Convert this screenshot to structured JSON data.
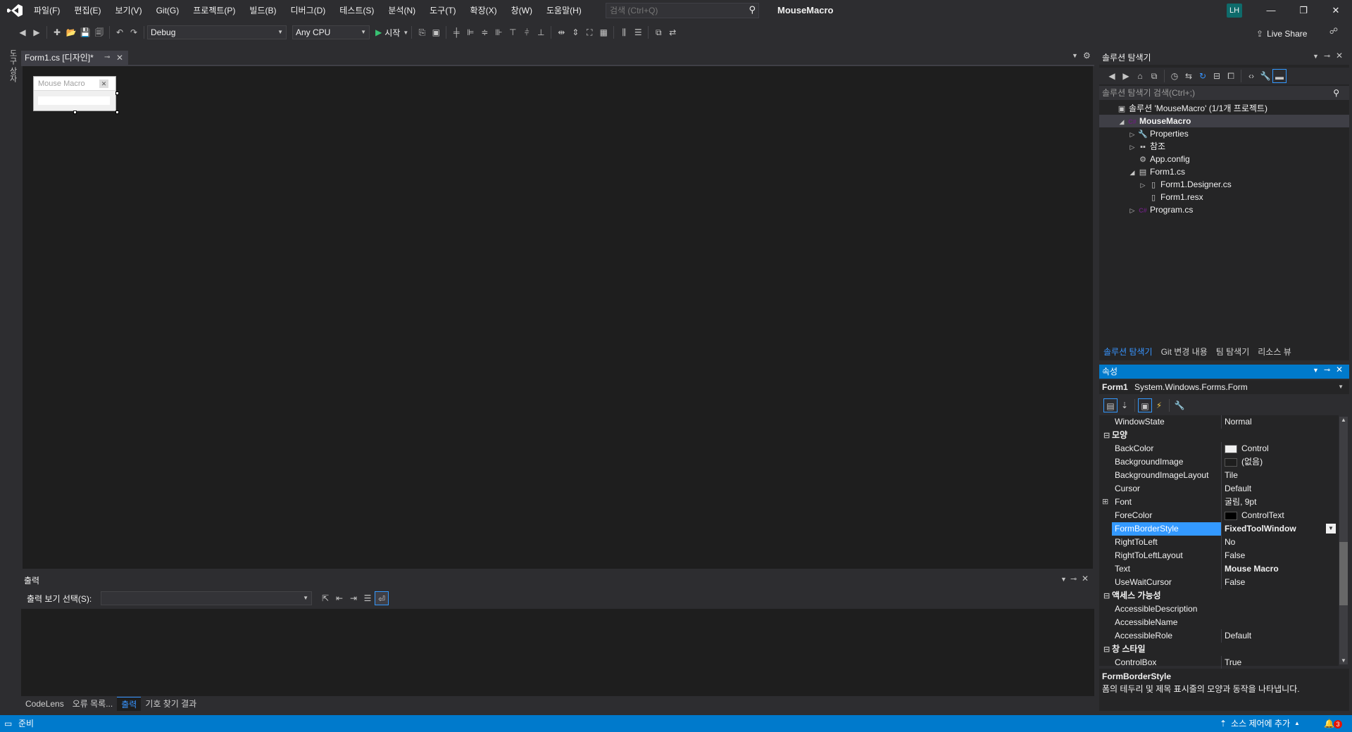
{
  "menu": {
    "items": [
      "파일(F)",
      "편집(E)",
      "보기(V)",
      "Git(G)",
      "프로젝트(P)",
      "빌드(B)",
      "디버그(D)",
      "테스트(S)",
      "분석(N)",
      "도구(T)",
      "확장(X)",
      "창(W)",
      "도움말(H)"
    ],
    "search_placeholder": "검색 (Ctrl+Q)",
    "solution_name": "MouseMacro",
    "avatar_initials": "LH"
  },
  "toolbar": {
    "configuration": "Debug",
    "platform": "Any CPU",
    "start_label": "시작",
    "live_share_label": "Live Share"
  },
  "left_strip": {
    "toolbox_label": "도구 상자"
  },
  "document": {
    "tab_title": "Form1.cs [디자인]*",
    "form_title": "Mouse Macro"
  },
  "output": {
    "title": "출력",
    "source_label": "출력 보기 선택(S):",
    "source_value": ""
  },
  "bottom_tabs": [
    {
      "label": "CodeLens",
      "active": false
    },
    {
      "label": "오류 목록...",
      "active": false
    },
    {
      "label": "출력",
      "active": true
    },
    {
      "label": "기호 찾기 결과",
      "active": false
    }
  ],
  "solution_explorer": {
    "title": "솔루션 탐색기",
    "search_placeholder": "솔루션 탐색기 검색(Ctrl+;)",
    "tree": [
      {
        "label": "솔루션 'MouseMacro' (1/1개 프로젝트)",
        "icon": "solution-icon",
        "glyph": "▣",
        "twisty": "",
        "indent": 0,
        "bold": false,
        "selected": false
      },
      {
        "label": "MouseMacro",
        "icon": "csharp-project-icon",
        "glyph": "C#",
        "twisty": "◢",
        "indent": 1,
        "bold": true,
        "selected": true
      },
      {
        "label": "Properties",
        "icon": "wrench-icon",
        "glyph": "🔧",
        "twisty": "▷",
        "indent": 2,
        "bold": false,
        "selected": false
      },
      {
        "label": "참조",
        "icon": "references-icon",
        "glyph": "▪▪",
        "twisty": "▷",
        "indent": 2,
        "bold": false,
        "selected": false
      },
      {
        "label": "App.config",
        "icon": "config-file-icon",
        "glyph": "⚙",
        "twisty": "",
        "indent": 2,
        "bold": false,
        "selected": false
      },
      {
        "label": "Form1.cs",
        "icon": "form-icon",
        "glyph": "▤",
        "twisty": "◢",
        "indent": 2,
        "bold": false,
        "selected": false
      },
      {
        "label": "Form1.Designer.cs",
        "icon": "code-file-icon",
        "glyph": "▯",
        "twisty": "▷",
        "indent": 3,
        "bold": false,
        "selected": false
      },
      {
        "label": "Form1.resx",
        "icon": "resource-file-icon",
        "glyph": "▯",
        "twisty": "",
        "indent": 3,
        "bold": false,
        "selected": false
      },
      {
        "label": "Program.cs",
        "icon": "csharp-file-icon",
        "glyph": "C#",
        "twisty": "▷",
        "indent": 2,
        "bold": false,
        "selected": false
      }
    ],
    "tabs": [
      {
        "label": "솔루션 탐색기",
        "active": true
      },
      {
        "label": "Git 변경 내용",
        "active": false
      },
      {
        "label": "팀 탐색기",
        "active": false
      },
      {
        "label": "리소스 뷰",
        "active": false
      }
    ]
  },
  "properties": {
    "title": "속성",
    "object_name": "Form1",
    "object_type": "System.Windows.Forms.Form",
    "rows": [
      {
        "kind": "prop",
        "name": "WindowState",
        "value": "Normal"
      },
      {
        "kind": "cat",
        "toggle": "⊟",
        "name": "모양"
      },
      {
        "kind": "prop",
        "name": "BackColor",
        "value": "Control",
        "swatch": "#f0f0f0"
      },
      {
        "kind": "prop",
        "name": "BackgroundImage",
        "value": "(없음)",
        "swatch": "#1e1e1e"
      },
      {
        "kind": "prop",
        "name": "BackgroundImageLayout",
        "value": "Tile"
      },
      {
        "kind": "prop",
        "name": "Cursor",
        "value": "Default"
      },
      {
        "kind": "prop",
        "name": "Font",
        "value": "굴림, 9pt",
        "expand": "⊞"
      },
      {
        "kind": "prop",
        "name": "ForeColor",
        "value": "ControlText",
        "swatch": "#000000"
      },
      {
        "kind": "prop",
        "name": "FormBorderStyle",
        "value": "FixedToolWindow",
        "bold": true,
        "highlight": true
      },
      {
        "kind": "prop",
        "name": "RightToLeft",
        "value": "No"
      },
      {
        "kind": "prop",
        "name": "RightToLeftLayout",
        "value": "False"
      },
      {
        "kind": "prop",
        "name": "Text",
        "value": "Mouse Macro",
        "bold": true
      },
      {
        "kind": "prop",
        "name": "UseWaitCursor",
        "value": "False"
      },
      {
        "kind": "cat",
        "toggle": "⊟",
        "name": "액세스 가능성"
      },
      {
        "kind": "prop",
        "name": "AccessibleDescription",
        "value": ""
      },
      {
        "kind": "prop",
        "name": "AccessibleName",
        "value": ""
      },
      {
        "kind": "prop",
        "name": "AccessibleRole",
        "value": "Default"
      },
      {
        "kind": "cat",
        "toggle": "⊟",
        "name": "창 스타일"
      },
      {
        "kind": "prop",
        "name": "ControlBox",
        "value": "True"
      }
    ],
    "description_title": "FormBorderStyle",
    "description_text": "폼의 테두리 및 제목 표시줄의 모양과 동작을 나타냅니다."
  },
  "status": {
    "ready": "준비",
    "source_control": "소스 제어에 추가",
    "notification_count": "3"
  },
  "colors": {
    "accent": "#007acc",
    "selection": "#3399ff",
    "editor_bg": "#1e1e1e",
    "chrome_bg": "#2d2d30"
  }
}
